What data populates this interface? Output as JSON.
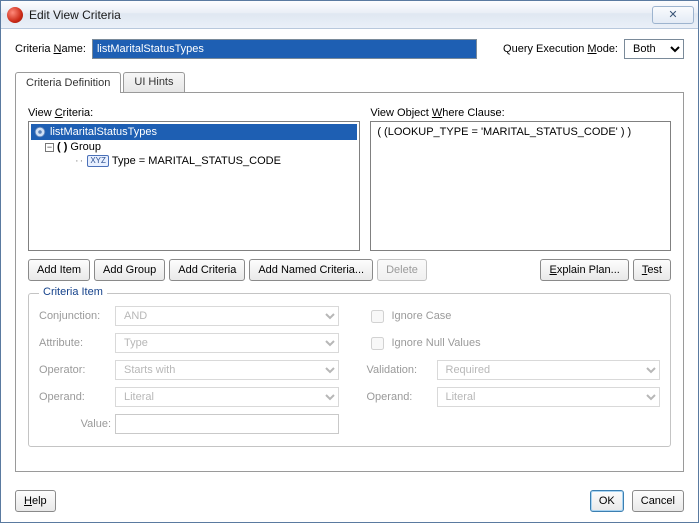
{
  "window": {
    "title": "Edit View Criteria",
    "close_glyph": "✕"
  },
  "top": {
    "name_label_pre": "Criteria ",
    "name_label_u": "N",
    "name_label_post": "ame:",
    "name_value": "listMaritalStatusTypes",
    "qmode_label_pre": "Query Execution ",
    "qmode_label_u": "M",
    "qmode_label_post": "ode:",
    "qmode_value": "Both"
  },
  "tabs": {
    "definition": "Criteria Definition",
    "uihints": "UI Hints"
  },
  "panels": {
    "vc_label_pre": "View ",
    "vc_label_u": "C",
    "vc_label_post": "riteria:",
    "where_label_pre": "View Object ",
    "where_label_u": "W",
    "where_label_post": "here Clause:",
    "where_text": "( (LOOKUP_TYPE = 'MARITAL_STATUS_CODE' ) )"
  },
  "tree": {
    "root": "listMaritalStatusTypes",
    "group": "Group",
    "item": "Type = MARITAL_STATUS_CODE"
  },
  "buttons": {
    "add_item": "Add Item",
    "add_group": "Add Group",
    "add_criteria": "Add Criteria",
    "add_named": "Add Named Criteria...",
    "delete": "Delete",
    "explain": "Explain Plan...",
    "test": "Test"
  },
  "criteria_item": {
    "legend": "Criteria Item",
    "conjunction_lbl": "Conjunction:",
    "conjunction_val": "AND",
    "attribute_lbl": "Attribute:",
    "attribute_val": "Type",
    "operator_lbl": "Operator:",
    "operator_val": "Starts with",
    "operand_lbl": "Operand:",
    "operand_val": "Literal",
    "value_lbl": "Value:",
    "value_val": "",
    "ignore_case": "Ignore Case",
    "ignore_null": "Ignore Null Values",
    "validation_lbl": "Validation:",
    "validation_val": "Required",
    "operand2_lbl": "Operand:",
    "operand2_val": "Literal"
  },
  "footer": {
    "help": "Help",
    "ok": "OK",
    "cancel": "Cancel"
  }
}
